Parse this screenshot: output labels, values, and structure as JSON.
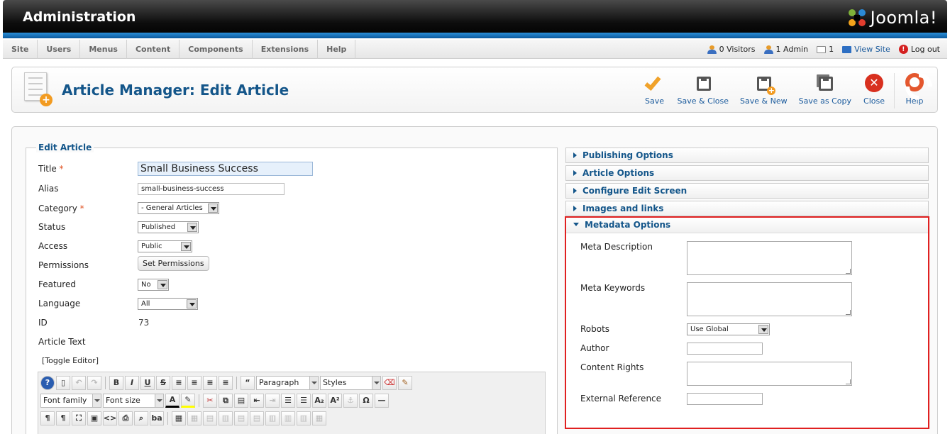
{
  "header": {
    "title": "Administration",
    "logo_text": "Joomla!"
  },
  "menu": [
    "Site",
    "Users",
    "Menus",
    "Content",
    "Components",
    "Extensions",
    "Help"
  ],
  "status": {
    "visitors": "0 Visitors",
    "admins": "1 Admin",
    "messages": "1",
    "view_site": "View Site",
    "logout": "Log out"
  },
  "toolbar": {
    "page_title": "Article Manager: Edit Article",
    "buttons": [
      "Save",
      "Save & Close",
      "Save & New",
      "Save as Copy",
      "Close",
      "Help"
    ]
  },
  "form": {
    "legend": "Edit Article",
    "title_label": "Title",
    "title_value": "Small Business Success",
    "alias_label": "Alias",
    "alias_value": "small-business-success",
    "category_label": "Category",
    "category_value": "- General Articles",
    "status_label": "Status",
    "status_value": "Published",
    "access_label": "Access",
    "access_value": "Public",
    "permissions_label": "Permissions",
    "permissions_button": "Set Permissions",
    "featured_label": "Featured",
    "featured_value": "No",
    "language_label": "Language",
    "language_value": "All",
    "id_label": "ID",
    "id_value": "73",
    "article_text_label": "Article Text",
    "toggle_editor": "[Toggle Editor]",
    "required_mark": "*"
  },
  "editor": {
    "format_select": "Paragraph",
    "styles_select": "Styles",
    "font_family": "Font family",
    "font_size": "Font size"
  },
  "panels": {
    "publishing": "Publishing Options",
    "article": "Article Options",
    "configure": "Configure Edit Screen",
    "images": "Images and links",
    "metadata": "Metadata Options"
  },
  "metadata": {
    "meta_description": "Meta Description",
    "meta_keywords": "Meta Keywords",
    "robots": "Robots",
    "robots_value": "Use Global",
    "author": "Author",
    "content_rights": "Content Rights",
    "external_reference": "External Reference"
  },
  "colors": {
    "accent_blue": "#14568a",
    "highlight_red": "#e02020",
    "header_bar": "#0c5a9e"
  }
}
